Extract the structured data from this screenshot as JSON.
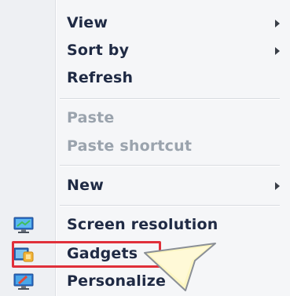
{
  "context_menu": {
    "items": [
      {
        "label": "View",
        "has_submenu": true,
        "enabled": true
      },
      {
        "label": "Sort by",
        "has_submenu": true,
        "enabled": true
      },
      {
        "label": "Refresh",
        "has_submenu": false,
        "enabled": true
      },
      {
        "label": "Paste",
        "has_submenu": false,
        "enabled": false
      },
      {
        "label": "Paste shortcut",
        "has_submenu": false,
        "enabled": false
      },
      {
        "label": "New",
        "has_submenu": true,
        "enabled": true
      },
      {
        "label": "Screen resolution",
        "icon": "monitor-icon",
        "enabled": true
      },
      {
        "label": "Gadgets",
        "icon": "gadgets-icon",
        "enabled": true,
        "highlighted": true
      },
      {
        "label": "Personalize",
        "icon": "personalize-icon",
        "enabled": true
      }
    ]
  },
  "colors": {
    "highlight_border": "#e0303a",
    "text": "#1f2a44",
    "disabled_text": "#9aa3ad"
  }
}
